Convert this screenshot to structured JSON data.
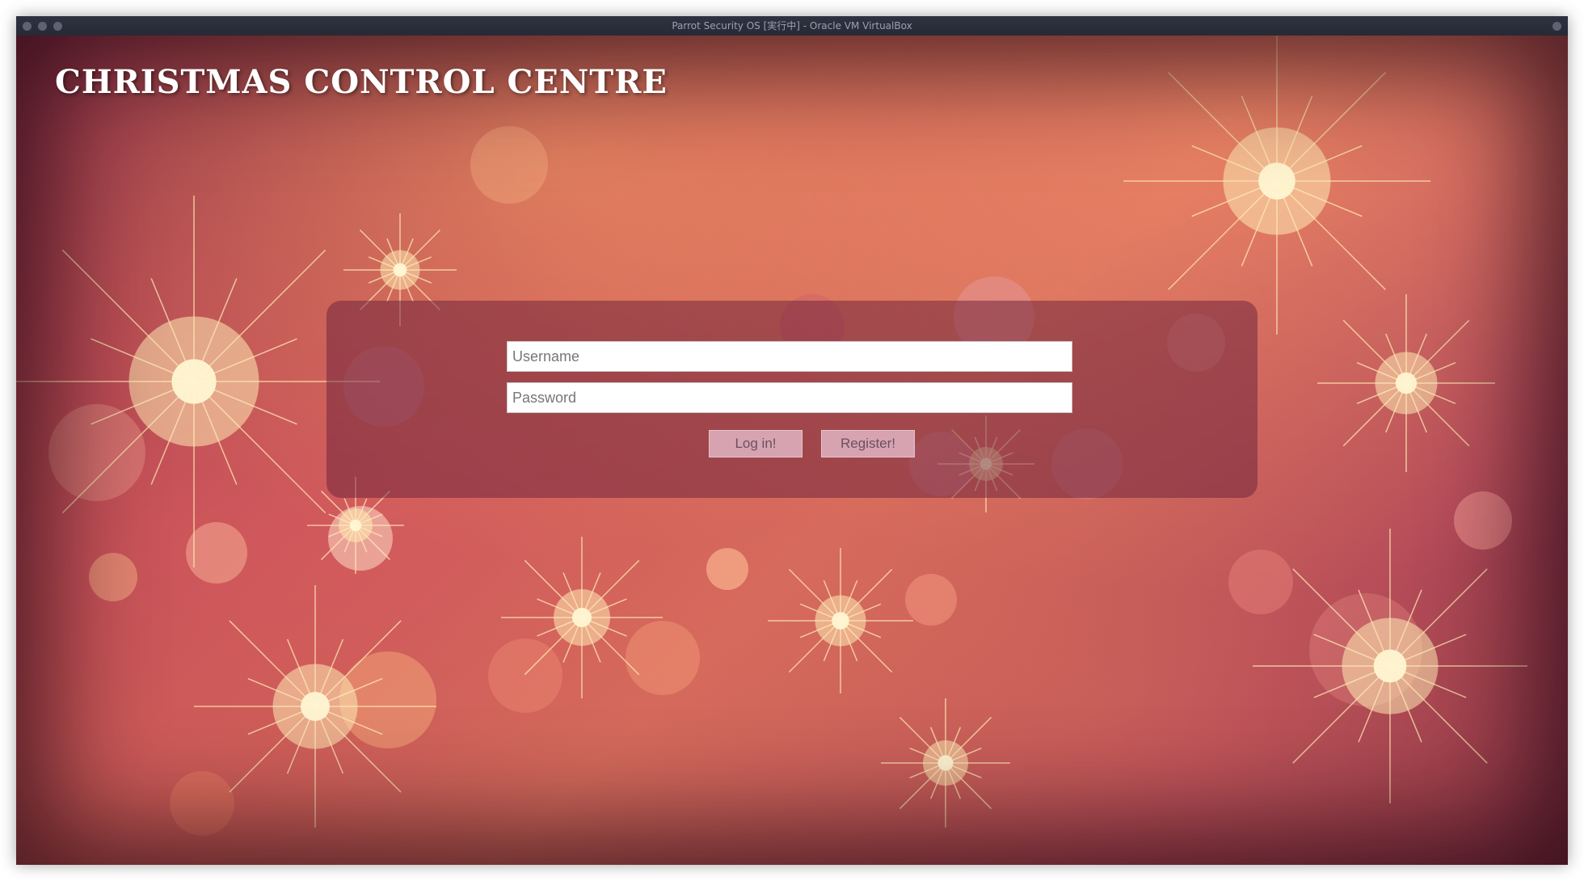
{
  "window": {
    "title": "Parrot Security OS [実行中] - Oracle VM VirtualBox"
  },
  "page": {
    "title": "CHRISTMAS CONTROL CENTRE"
  },
  "login": {
    "username_placeholder": "Username",
    "username_value": "",
    "password_placeholder": "Password",
    "password_value": "",
    "login_label": "Log in!",
    "register_label": "Register!"
  },
  "colors": {
    "title_text": "#ffffff",
    "panel_background": "rgba(110,35,60,0.52)",
    "button_background": "rgba(225,180,195,0.85)"
  }
}
